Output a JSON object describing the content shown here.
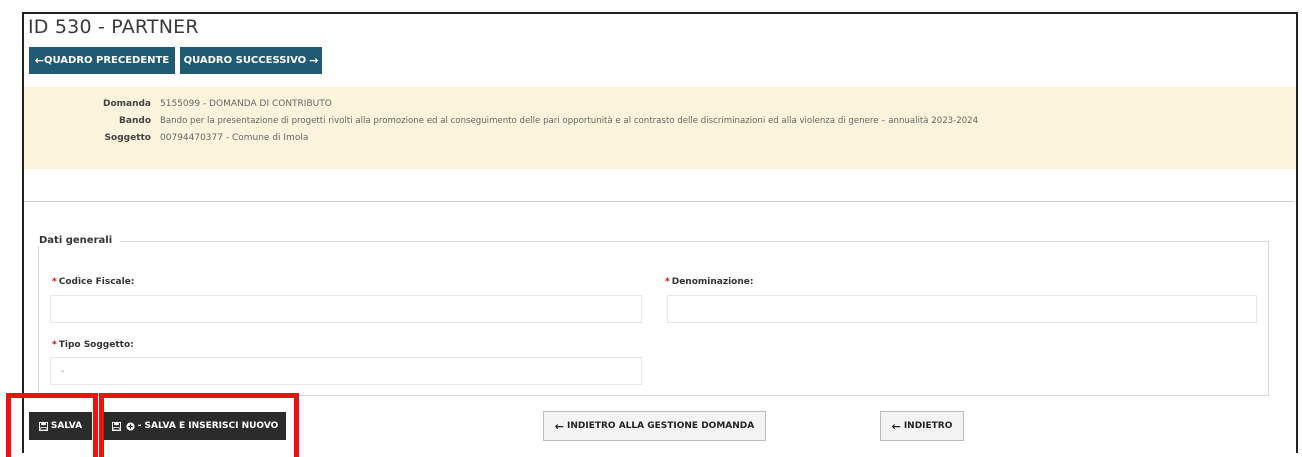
{
  "page": {
    "title": "ID 530 - PARTNER"
  },
  "nav": {
    "prev_label": "QUADRO PRECEDENTE",
    "next_label": "QUADRO SUCCESSIVO"
  },
  "info": {
    "domanda_label": "Domanda",
    "domanda_value": "5155099 - DOMANDA DI CONTRIBUTO",
    "bando_label": "Bando",
    "bando_value": "Bando per la presentazione di progetti rivolti alla promozione ed al conseguimento delle pari opportunità e al contrasto delle discriminazioni ed alla violenza di genere – annualità 2023-2024",
    "soggetto_label": "Soggetto",
    "soggetto_value": "00794470377 - Comune di Imola"
  },
  "form": {
    "legend": "Dati generali",
    "codice_fiscale_label": "Codice Fiscale:",
    "codice_fiscale_value": "",
    "denominazione_label": "Denominazione:",
    "denominazione_value": "",
    "tipo_soggetto_label": "Tipo Soggetto:",
    "tipo_soggetto_value": "-"
  },
  "actions": {
    "salva_label": "SALVA",
    "salva_inserisci_label": "- SALVA E INSERISCI NUOVO",
    "indietro_gestione_label": "INDIETRO ALLA GESTIONE DOMANDA",
    "indietro_label": "INDIETRO"
  },
  "colors": {
    "primary": "#1f5c73",
    "info_bg": "#fbf3dc",
    "dark_button": "#2b2b2b",
    "highlight": "#ee1111",
    "required": "#dd0000"
  },
  "icons": {
    "arrow_left": "arrow-left-icon",
    "arrow_right": "arrow-right-icon",
    "save": "floppy-disk-icon",
    "plus_circle": "plus-circle-icon"
  }
}
